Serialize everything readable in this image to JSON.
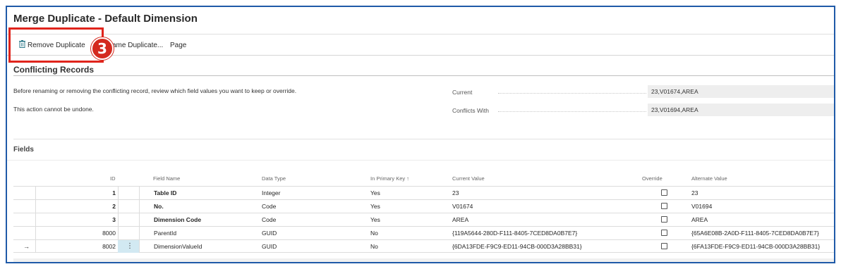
{
  "window": {
    "title": "Merge Duplicate - Default Dimension"
  },
  "actions": {
    "remove_label": "Remove Duplicate",
    "rename_label": "ame Duplicate...",
    "page_label": "Page"
  },
  "annotation": {
    "step_number": "3",
    "highlight_color": "#e0241c",
    "badge_color": "#d42a1f"
  },
  "conflicting": {
    "title": "Conflicting Records",
    "info_line1": "Before renaming or removing the conflicting record, review which field values you want to keep or override.",
    "info_line2": "This action cannot be undone.",
    "current_label": "Current",
    "current_value": "23,V01674,AREA",
    "conflicts_label": "Conflicts With",
    "conflicts_value": "23,V01694,AREA"
  },
  "fields": {
    "title": "Fields",
    "columns": {
      "id": "ID",
      "field_name": "Field Name",
      "data_type": "Data Type",
      "in_primary_key": "In Primary Key ↑",
      "current_value": "Current Value",
      "override": "Override",
      "alternate_value": "Alternate Value"
    },
    "rows": [
      {
        "id": "1",
        "field_name": "Table ID",
        "data_type": "Integer",
        "in_primary_key": "Yes",
        "current_value": "23",
        "override": false,
        "alternate_value": "23",
        "bold": true
      },
      {
        "id": "2",
        "field_name": "No.",
        "data_type": "Code",
        "in_primary_key": "Yes",
        "current_value": "V01674",
        "override": false,
        "alternate_value": "V01694",
        "bold": true
      },
      {
        "id": "3",
        "field_name": "Dimension Code",
        "data_type": "Code",
        "in_primary_key": "Yes",
        "current_value": "AREA",
        "override": false,
        "alternate_value": "AREA",
        "bold": true
      },
      {
        "id": "8000",
        "field_name": "ParentId",
        "data_type": "GUID",
        "in_primary_key": "No",
        "current_value": "{119A5644-280D-F111-8405-7CED8DA0B7E7}",
        "override": false,
        "alternate_value": "{65A6E08B-2A0D-F111-8405-7CED8DA0B7E7}",
        "bold": false
      },
      {
        "id": "8002",
        "field_name": "DimensionValueId",
        "data_type": "GUID",
        "in_primary_key": "No",
        "current_value": "{6DA13FDE-F9C9-ED11-94CB-000D3A28BB31}",
        "override": false,
        "alternate_value": "{6FA13FDE-F9C9-ED11-94CB-000D3A28BB31}",
        "bold": false,
        "selected": true
      }
    ],
    "row_indicator": "→",
    "row_menu_glyph": "⋮"
  },
  "colors": {
    "frame_border": "#1f5aa8",
    "selected_cell": "#d2e9f2"
  }
}
